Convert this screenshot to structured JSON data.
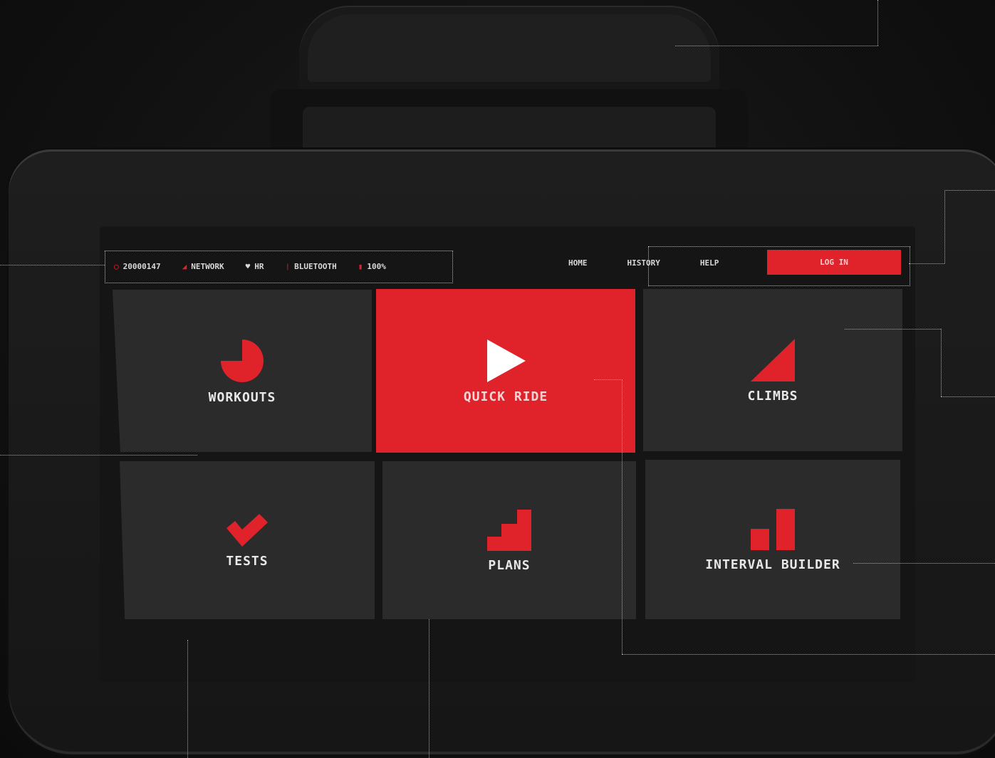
{
  "status_bar": {
    "device_id": "20000147",
    "network": "NETWORK",
    "hr": "HR",
    "bluetooth": "BLUETOOTH",
    "battery": "100%"
  },
  "nav": {
    "home": "HOME",
    "history": "HISTORY",
    "help": "HELP",
    "login": "LOG IN"
  },
  "tiles": [
    {
      "label": "WORKOUTS",
      "icon": "pie-icon"
    },
    {
      "label": "QUICK RIDE",
      "icon": "play-icon",
      "active": true
    },
    {
      "label": "CLIMBS",
      "icon": "triangle-icon"
    },
    {
      "label": "TESTS",
      "icon": "check-icon"
    },
    {
      "label": "PLANS",
      "icon": "stairs-icon"
    },
    {
      "label": "INTERVAL BUILDER",
      "icon": "bars-icon"
    }
  ],
  "colors": {
    "accent": "#e0232a",
    "tile": "#2b2b2b",
    "background": "#111111"
  }
}
